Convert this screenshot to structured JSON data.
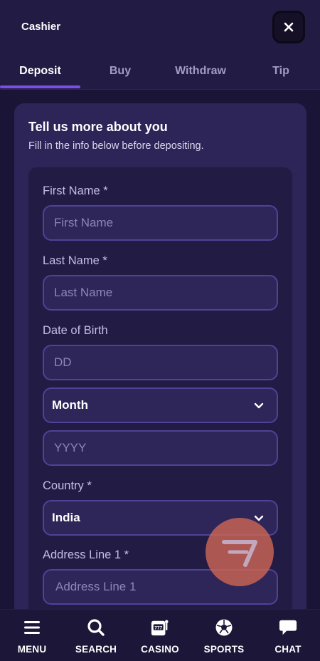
{
  "header": {
    "title": "Cashier"
  },
  "tabs": [
    {
      "label": "Deposit",
      "active": true
    },
    {
      "label": "Buy",
      "active": false
    },
    {
      "label": "Withdraw",
      "active": false
    },
    {
      "label": "Tip",
      "active": false
    }
  ],
  "form": {
    "title": "Tell us more about you",
    "subtitle": "Fill in the info below before depositing.",
    "first_name": {
      "label": "First Name *",
      "placeholder": "First Name"
    },
    "last_name": {
      "label": "Last Name *",
      "placeholder": "Last Name"
    },
    "dob": {
      "label": "Date of Birth",
      "day_placeholder": "DD",
      "month_value": "Month",
      "year_placeholder": "YYYY"
    },
    "country": {
      "label": "Country *",
      "value": "India"
    },
    "address1": {
      "label": "Address Line 1 *",
      "placeholder": "Address Line 1"
    }
  },
  "bottom_nav": [
    {
      "label": "MENU",
      "icon": "menu-icon"
    },
    {
      "label": "SEARCH",
      "icon": "search-icon"
    },
    {
      "label": "CASINO",
      "icon": "slot-machine-icon"
    },
    {
      "label": "SPORTS",
      "icon": "soccer-ball-icon"
    },
    {
      "label": "CHAT",
      "icon": "chat-bubble-icon"
    }
  ],
  "colors": {
    "accent": "#7b4ee4",
    "background": "#1a1437",
    "card": "#2d2457",
    "field_border": "#4e4396"
  }
}
